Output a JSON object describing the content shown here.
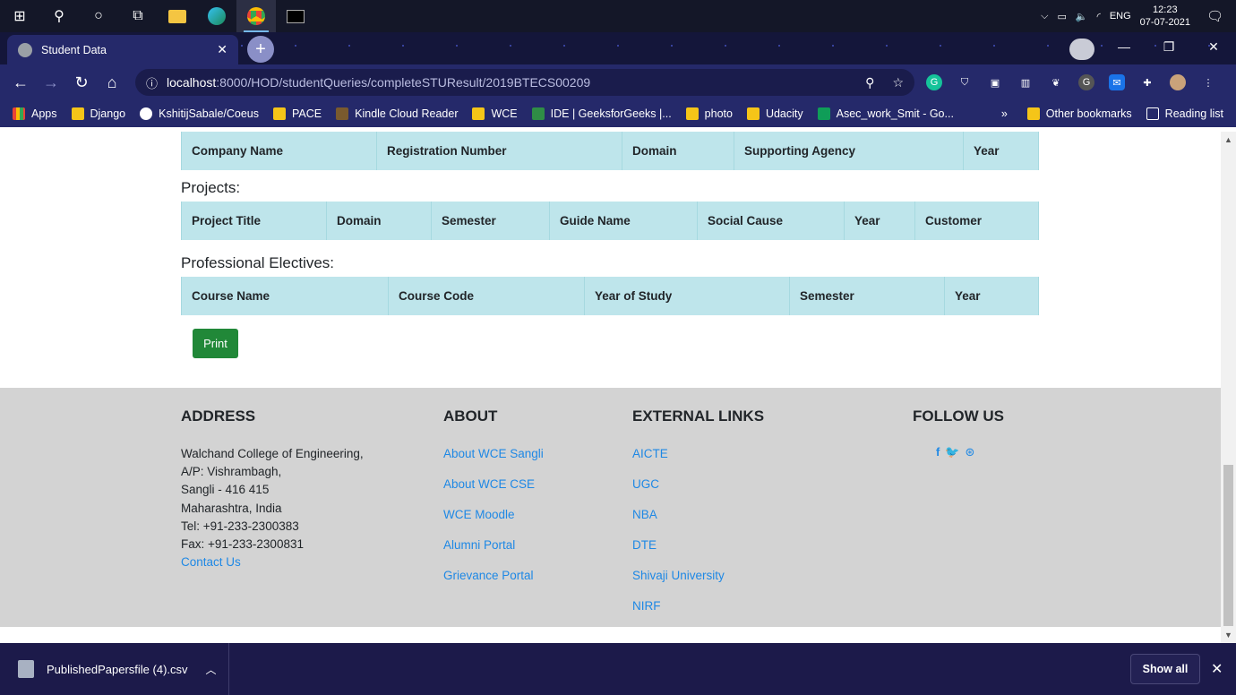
{
  "taskbar": {
    "time": "12:23",
    "date": "07-07-2021",
    "lang": "ENG"
  },
  "browser": {
    "tab_title": "Student Data",
    "url_host": "localhost",
    "url_path": ":8000/HOD/studentQueries/completeSTUResult/2019BTECS00209"
  },
  "bookmarks": {
    "items": [
      "Apps",
      "Django",
      "KshitijSabale/Coeus",
      "PACE",
      "Kindle Cloud Reader",
      "WCE",
      "IDE | GeeksforGeeks |...",
      "photo",
      "Udacity",
      "Asec_work_Smit - Go..."
    ],
    "overflow": "»",
    "other": "Other bookmarks",
    "reading": "Reading list"
  },
  "page": {
    "internship_headers": [
      "Company Name",
      "Registration Number",
      "Domain",
      "Supporting Agency",
      "Year"
    ],
    "projects_title": "Projects:",
    "projects_headers": [
      "Project Title",
      "Domain",
      "Semester",
      "Guide Name",
      "Social Cause",
      "Year",
      "Customer"
    ],
    "electives_title": "Professional Electives:",
    "electives_headers": [
      "Course Name",
      "Course Code",
      "Year of Study",
      "Semester",
      "Year"
    ],
    "print_label": "Print"
  },
  "footer": {
    "address_title": "ADDRESS",
    "address_lines": [
      "Walchand College of Engineering,",
      "A/P: Vishrambagh,",
      "Sangli - 416 415",
      "Maharashtra, India",
      "Tel: +91-233-2300383",
      "Fax: +91-233-2300831"
    ],
    "contact_link": "Contact Us",
    "about_title": "ABOUT",
    "about_links": [
      "About WCE Sangli",
      "About WCE CSE",
      "WCE Moodle",
      "Alumni Portal",
      "Grievance Portal"
    ],
    "external_title": "EXTERNAL LINKS",
    "external_links": [
      "AICTE",
      "UGC",
      "NBA",
      "DTE",
      "Shivaji University",
      "NIRF"
    ],
    "follow_title": "FOLLOW US",
    "social": [
      "f",
      "🐦",
      "⊛"
    ]
  },
  "downloads": {
    "file": "PublishedPapersfile (4).csv",
    "show_all": "Show all"
  },
  "colors": {
    "table_header": "#bee5eb",
    "link": "#1e88e5",
    "print_button": "#218838",
    "footer_bg": "#d3d3d3"
  }
}
